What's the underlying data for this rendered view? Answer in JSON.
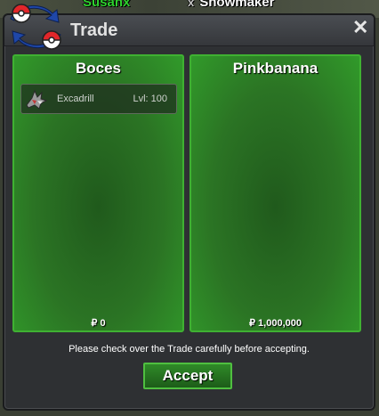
{
  "world": {
    "player_left": "Susanx",
    "player_right": "Snowmaker",
    "player_right_mark": "x"
  },
  "window": {
    "title": "Trade",
    "close_glyph": "✕"
  },
  "left_panel": {
    "name": "Boces",
    "items": [
      {
        "name": "Excadrill",
        "level": "Lvl: 100",
        "icon": "excadrill-icon"
      }
    ],
    "money": "₽ 0"
  },
  "right_panel": {
    "name": "Pinkbanana",
    "items": [],
    "money": "₽ 1,000,000"
  },
  "notice": "Please check over the Trade carefully before accepting.",
  "accept_label": "Accept"
}
